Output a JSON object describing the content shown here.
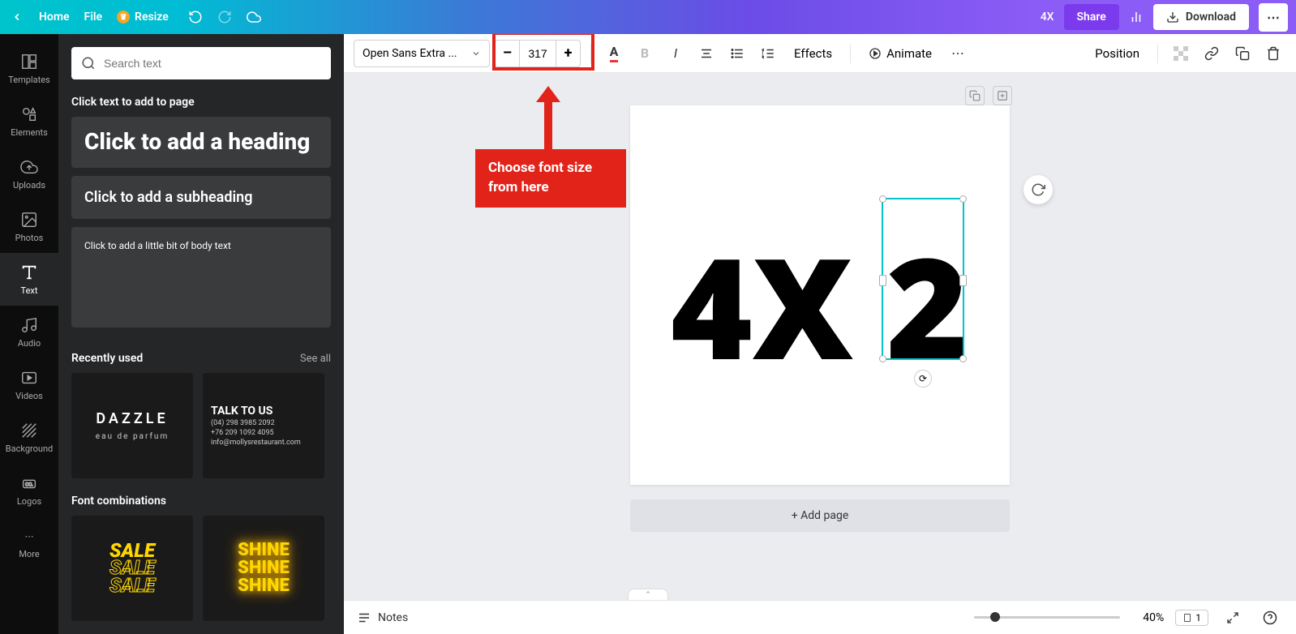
{
  "topbar": {
    "home": "Home",
    "file": "File",
    "resize": "Resize",
    "doc_title": "4X",
    "share": "Share",
    "download": "Download"
  },
  "rail": {
    "templates": "Templates",
    "elements": "Elements",
    "uploads": "Uploads",
    "photos": "Photos",
    "text": "Text",
    "audio": "Audio",
    "videos": "Videos",
    "background": "Background",
    "logos": "Logos",
    "more": "More"
  },
  "sidepanel": {
    "search_placeholder": "Search text",
    "click_to_add": "Click text to add to page",
    "heading": "Click to add a heading",
    "subheading": "Click to add a subheading",
    "body": "Click to add a little bit of body text",
    "recently_used": "Recently used",
    "see_all": "See all",
    "font_combinations": "Font combinations",
    "thumb1_title": "DAZZLE",
    "thumb1_sub": "eau de parfum",
    "thumb2_title": "TALK TO US",
    "thumb2_l1": "(04) 298 3985 2092",
    "thumb2_l2": "+76 209 1092 4095",
    "thumb2_l3": "info@mollysrestaurant.com",
    "thumb3_a": "SALE",
    "thumb3_b": "SALE",
    "thumb3_c": "SALE",
    "thumb4_a": "SHINE",
    "thumb4_b": "SHINE",
    "thumb4_c": "SHINE"
  },
  "toolbar": {
    "font_name": "Open Sans Extra ...",
    "font_size": "317",
    "effects": "Effects",
    "animate": "Animate",
    "position": "Position"
  },
  "canvas": {
    "text_4x": "4X",
    "text_2": "2",
    "add_page": "+ Add page"
  },
  "annotation": {
    "text": "Choose font size from here"
  },
  "bottom": {
    "notes": "Notes",
    "zoom": "40%",
    "page_num": "1"
  }
}
